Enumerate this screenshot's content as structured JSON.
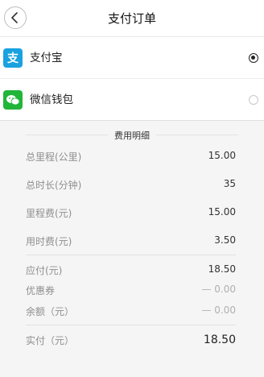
{
  "header": {
    "title": "支付订单"
  },
  "payment_methods": [
    {
      "label": "支付宝",
      "icon": "alipay-icon",
      "selected": true
    },
    {
      "label": "微信钱包",
      "icon": "wechat-icon",
      "selected": false
    }
  ],
  "details": {
    "heading": "费用明细",
    "items": [
      {
        "label": "总里程(公里)",
        "value": "15.00"
      },
      {
        "label": "总时长(分钟)",
        "value": "35"
      },
      {
        "label": "里程费(元)",
        "value": "15.00"
      },
      {
        "label": "用时费(元)",
        "value": "3.50"
      }
    ],
    "summary": [
      {
        "label": "应付(元)",
        "value": "18.50"
      },
      {
        "label": "优惠券",
        "value": "— 0.00"
      },
      {
        "label": "余额（元）",
        "value": "— 0.00"
      }
    ],
    "total": {
      "label": "实付（元）",
      "value": "18.50"
    }
  },
  "colors": {
    "alipay": "#1aa1e0",
    "wechat": "#21b53a",
    "background": "#f5f5f5"
  }
}
